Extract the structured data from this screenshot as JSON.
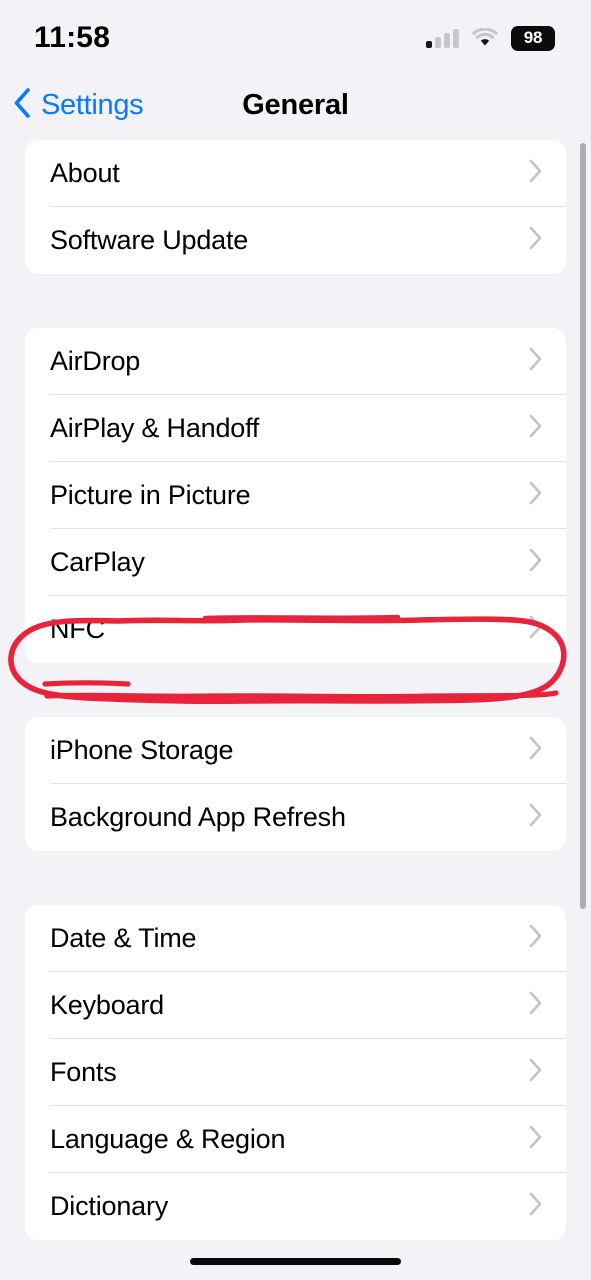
{
  "status_bar": {
    "time": "11:58",
    "signal_icon": "cellular-signal-icon",
    "wifi_icon": "wifi-icon",
    "battery_level": "98",
    "battery_icon": "battery-icon"
  },
  "nav": {
    "back_label": "Settings",
    "back_icon": "chevron-left-icon",
    "title": "General"
  },
  "colors": {
    "accent_blue": "#0A7AFF",
    "background": "#F2F2F7",
    "card": "#FFFFFF",
    "separator": "#E3E3E6",
    "chevron": "#C2C2C7",
    "annotation_red": "#E8243C",
    "scrollbar": "#AEAEB2"
  },
  "groups": [
    {
      "name": "group-about",
      "rows": [
        {
          "label": "About",
          "chevron": "chevron-right-icon"
        },
        {
          "label": "Software Update",
          "chevron": "chevron-right-icon"
        }
      ]
    },
    {
      "name": "group-connectivity",
      "rows": [
        {
          "label": "AirDrop",
          "chevron": "chevron-right-icon"
        },
        {
          "label": "AirPlay & Handoff",
          "chevron": "chevron-right-icon"
        },
        {
          "label": "Picture in Picture",
          "chevron": "chevron-right-icon"
        },
        {
          "label": "CarPlay",
          "chevron": "chevron-right-icon"
        },
        {
          "label": "NFC",
          "chevron": "chevron-right-icon"
        }
      ]
    },
    {
      "name": "group-storage",
      "rows": [
        {
          "label": "iPhone Storage",
          "chevron": "chevron-right-icon"
        },
        {
          "label": "Background App Refresh",
          "chevron": "chevron-right-icon"
        }
      ]
    },
    {
      "name": "group-localization",
      "rows": [
        {
          "label": "Date & Time",
          "chevron": "chevron-right-icon"
        },
        {
          "label": "Keyboard",
          "chevron": "chevron-right-icon"
        },
        {
          "label": "Fonts",
          "chevron": "chevron-right-icon"
        },
        {
          "label": "Language & Region",
          "chevron": "chevron-right-icon"
        },
        {
          "label": "Dictionary",
          "chevron": "chevron-right-icon"
        }
      ]
    }
  ],
  "annotation": {
    "name": "red-circle-annotation",
    "target_row_label": "NFC",
    "shape": "hand-drawn-ellipse"
  },
  "home_indicator": "home-indicator"
}
